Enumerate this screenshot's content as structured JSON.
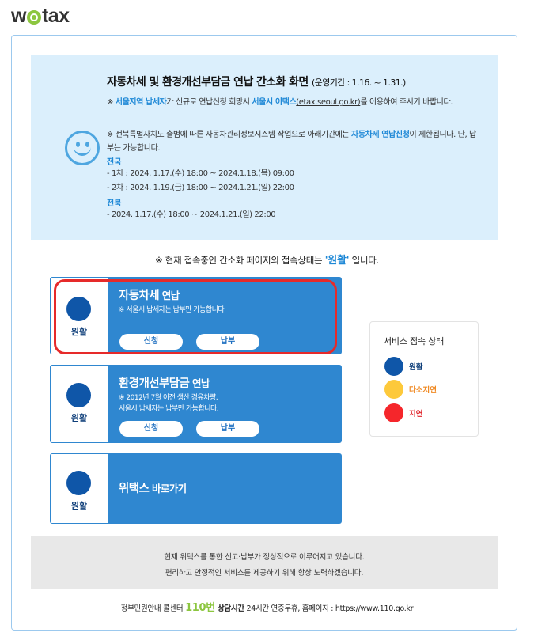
{
  "logo": {
    "pre": "w",
    "post": "tax"
  },
  "notice": {
    "title": "자동차세 및 환경개선부담금 연납 간소화 화면",
    "period": "(운영기간 : 1.16. ~ 1.31.)",
    "p1": {
      "pre": "※ ",
      "blue1": "서울지역 납세자",
      "mid": "가 신규로 연납신청 희망시 ",
      "blue2": "서울시 이택스",
      "link": "(etax.seoul.go.kr)",
      "post": "를 이용하여 주시기 바랍니다."
    },
    "p2": {
      "pre": "※ 전북특별자치도 출범에 따른 자동차관리정보시스템 작업으로 아래기간에는 ",
      "blue": "자동차세 연납신청",
      "post": "이 제한됩니다. 단, 납부는 가능합니다."
    },
    "section1": "전국",
    "line1": "- 1차 : 2024. 1.17.(수) 18:00 ~ 2024.1.18.(목) 09:00",
    "line2": "- 2차 : 2024. 1.19.(금) 18:00 ~ 2024.1.21.(일) 22:00",
    "section2": "전북",
    "line3": "- 2024. 1.17.(수) 18:00 ~ 2024.1.21.(일) 22:00"
  },
  "status_line": {
    "pre": "※ 현재 접속중인 간소화 페이지의 접속상태는 ",
    "status": "'원활'",
    "post": " 입니다."
  },
  "cards": [
    {
      "status": "원활",
      "title": "자동차세",
      "title_small": " 연납",
      "desc1": "※ 서울시 납세자는 납부만 가능합니다.",
      "desc2": "",
      "btn_apply": "신청",
      "btn_pay": "납부"
    },
    {
      "status": "원활",
      "title": "환경개선부담금",
      "title_small": " 연납",
      "desc1": "※ 2012년 7월 이전 생산 경유차량,",
      "desc2": "서울시 납세자는 납부만 가능합니다.",
      "btn_apply": "신청",
      "btn_pay": "납부"
    },
    {
      "status": "원활",
      "title": "위택스",
      "title_small": " 바로가기"
    }
  ],
  "legend": {
    "title": "서비스 접속 상태",
    "items": [
      {
        "label": "원활",
        "color": "#0f56a8",
        "text_color": "#0f3f7a"
      },
      {
        "label": "다소지연",
        "color": "#fdc93b",
        "text_color": "#f08a24"
      },
      {
        "label": "지연",
        "color": "#f5262b",
        "text_color": "#e0242a"
      }
    ]
  },
  "bottom": {
    "line1": "현재 위택스를 통한 신고·납부가 정상적으로 이루어지고 있습니다.",
    "line2": "편리하고 안정적인 서비스를 제공하기 위해 항상 노력하겠습니다."
  },
  "footer": {
    "pre": "정부민원안내 콜센터 ",
    "number": "110번",
    "hours_label": " 상담시간",
    "hours": " 24시간 연중무휴, 홈페이지 : ",
    "url": "https://www.110.go.kr"
  }
}
